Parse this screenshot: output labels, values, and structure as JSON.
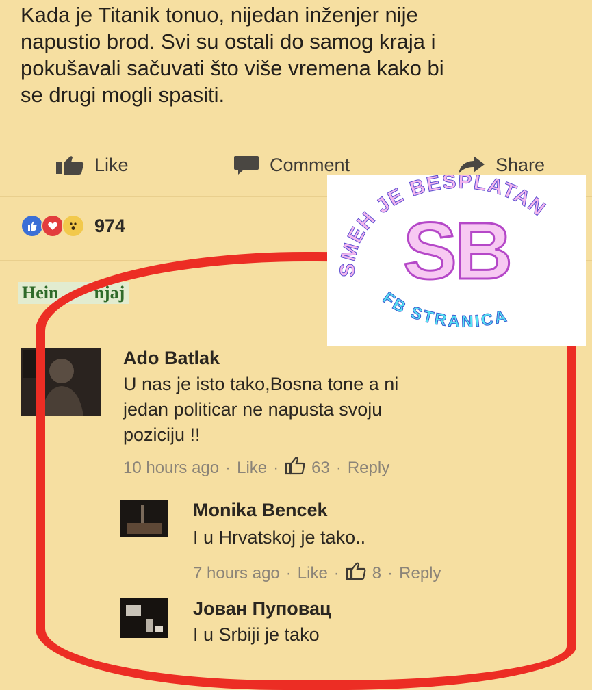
{
  "post": {
    "text_lines": [
      "Kada je Titanik tonuo, nijedan inženjer nije",
      "napustio brod. Svi su ostali do samog kraja i",
      "pokušavali sačuvati što više vremena kako bi",
      "se drugi mogli spasiti."
    ]
  },
  "actions": {
    "like": "Like",
    "comment": "Comment",
    "share": "Share"
  },
  "reactions": {
    "count": "974"
  },
  "page_tag": {
    "left": "Hein",
    "right": "njaj"
  },
  "comments": [
    {
      "name": "Ado Batlak",
      "lines": [
        "U nas je isto tako,Bosna tone a ni",
        "jedan politicar ne napusta svoju",
        "poziciju !!"
      ],
      "time": "10 hours ago",
      "like": "Like",
      "likes": "63",
      "reply": "Reply"
    },
    {
      "name": "Monika Bencek",
      "lines": [
        "I u Hrvatskoj je tako.."
      ],
      "time": "7 hours ago",
      "like": "Like",
      "likes": "8",
      "reply": "Reply"
    },
    {
      "name": "Јован Пуповац",
      "lines": [
        "I u Srbiji je tako"
      ]
    }
  ],
  "watermark": {
    "letters": "SB",
    "arc_top": "SMEH JE BESPLATAN",
    "arc_bottom": "FB STRANICA"
  },
  "colors": {
    "background": "#f6dfa1",
    "annotation": "#ec2d24",
    "logo_pink": "#f3b6ee",
    "logo_cyan": "#55e4f2"
  }
}
